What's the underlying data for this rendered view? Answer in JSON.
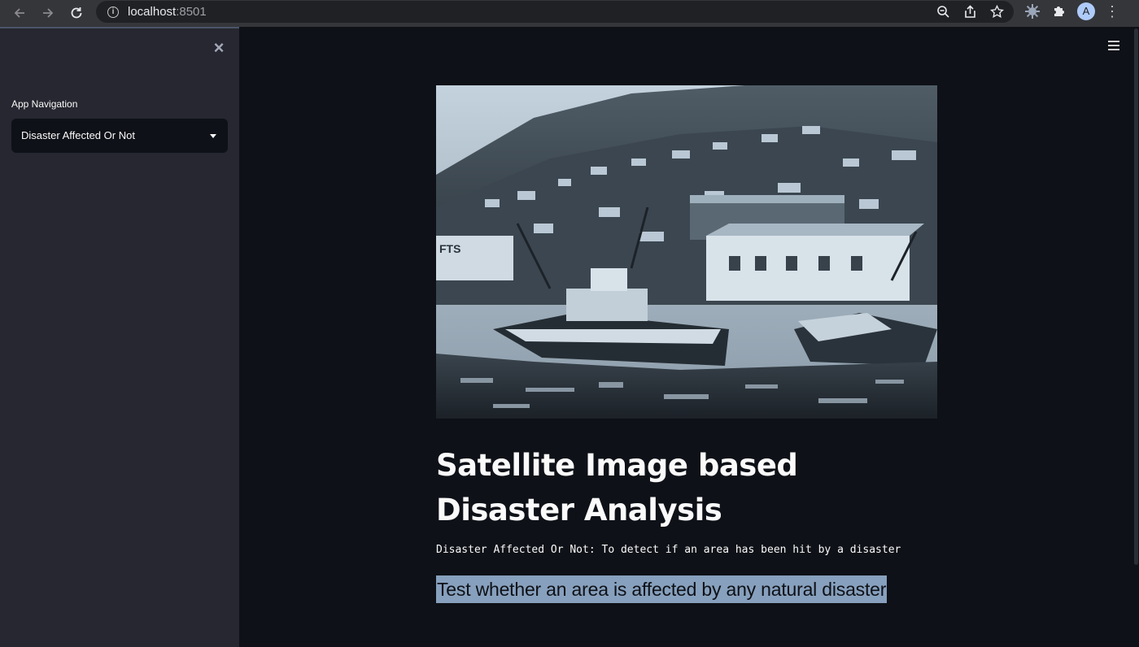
{
  "browser": {
    "url_host": "localhost",
    "url_port": ":8501",
    "avatar_initial": "A"
  },
  "sidebar": {
    "nav_label": "App Navigation",
    "select_value": "Disaster Affected Or Not"
  },
  "main": {
    "title": "Satellite Image based Disaster Analysis",
    "subtitle": "Disaster Affected Or Not: To detect if an area has been hit by a disaster",
    "highlight": "Test whether an area is affected by any natural disaster"
  },
  "colors": {
    "background": "#0e1117",
    "sidebar": "#262730",
    "highlight": "#87a0bd"
  }
}
